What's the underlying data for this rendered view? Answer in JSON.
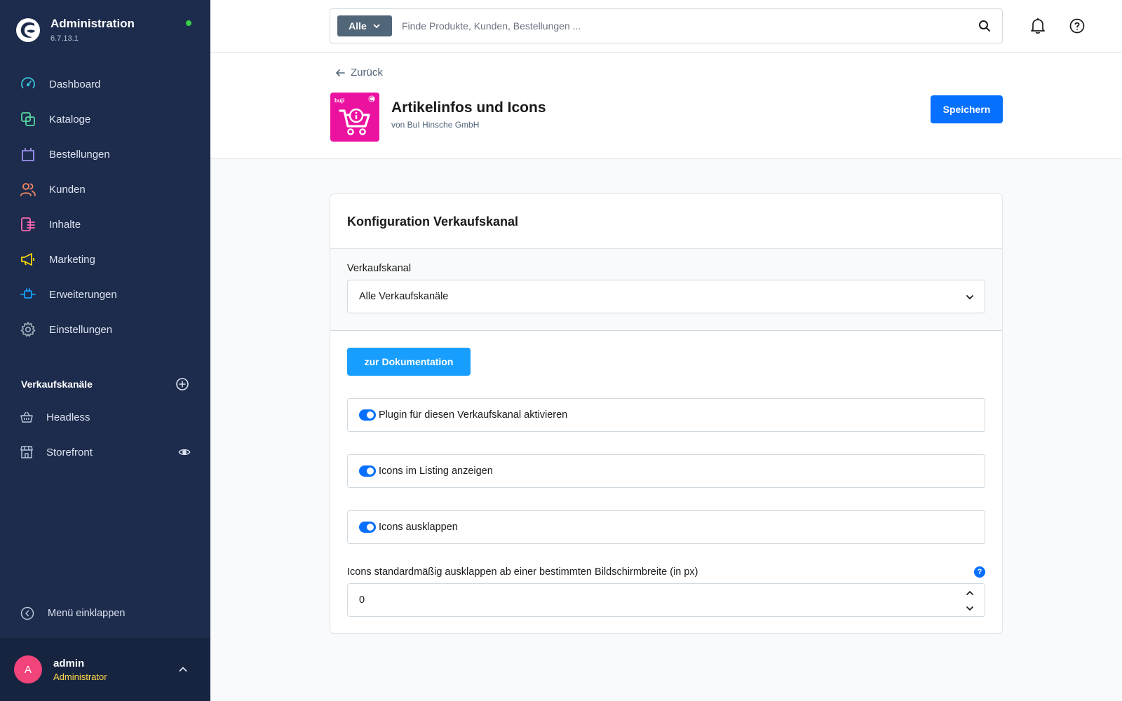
{
  "app": {
    "title": "Administration",
    "version": "6.7.13.1"
  },
  "sidebar": {
    "items": [
      {
        "label": "Dashboard",
        "icon": "dashboard-icon",
        "color": "#39c5d9"
      },
      {
        "label": "Kataloge",
        "icon": "catalogue-icon",
        "color": "#57d9a3"
      },
      {
        "label": "Bestellungen",
        "icon": "orders-icon",
        "color": "#a092f0"
      },
      {
        "label": "Kunden",
        "icon": "customers-icon",
        "color": "#f88962"
      },
      {
        "label": "Inhalte",
        "icon": "content-icon",
        "color": "#ff68b4"
      },
      {
        "label": "Marketing",
        "icon": "marketing-icon",
        "color": "#ffd700"
      },
      {
        "label": "Erweiterungen",
        "icon": "extensions-icon",
        "color": "#189eff"
      },
      {
        "label": "Einstellungen",
        "icon": "settings-icon",
        "color": "#9aa8b5"
      }
    ],
    "sales_channels": {
      "title": "Verkaufskanäle",
      "items": [
        {
          "label": "Headless",
          "icon": "basket-icon"
        },
        {
          "label": "Storefront",
          "icon": "storefront-icon"
        }
      ]
    },
    "collapse_label": "Menü einklappen",
    "user": {
      "initial": "A",
      "name": "admin",
      "role": "Administrator"
    }
  },
  "search": {
    "type_label": "Alle",
    "placeholder": "Finde Produkte, Kunden, Bestellungen ..."
  },
  "header": {
    "back_label": "Zurück",
    "plugin_title": "Artikelinfos und Icons",
    "plugin_vendor": "von BuI Hinsche GmbH",
    "plugin_icon_text": "buji",
    "save_label": "Speichern"
  },
  "card": {
    "title": "Konfiguration Verkaufskanal",
    "channel_label": "Verkaufskanal",
    "channel_value": "Alle Verkaufskanäle",
    "doc_button": "zur Dokumentation",
    "switches": [
      {
        "label": "Plugin für diesen Verkaufskanal aktivieren",
        "on": true
      },
      {
        "label": "Icons im Listing anzeigen",
        "on": true
      },
      {
        "label": "Icons ausklappen",
        "on": true
      }
    ],
    "breakpoint_label": "Icons standardmäßig ausklappen ab einer bestimmten Bildschirmbreite (in px)",
    "breakpoint_value": "0"
  },
  "colors": {
    "sidebar": "#1d2b4c",
    "primary": "#0870ff",
    "doc_button": "#189eff",
    "plugin_icon": "#ec12a0",
    "status_online": "#37d046"
  }
}
